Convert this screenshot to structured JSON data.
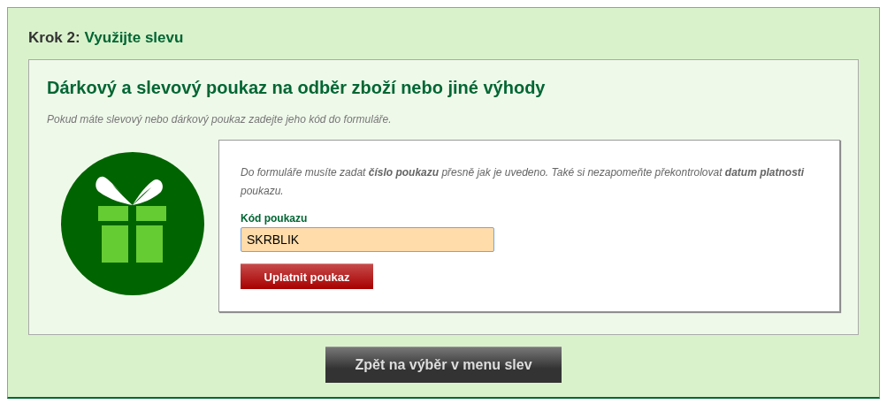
{
  "step": {
    "label": "Krok 2:",
    "title": "Využijte slevu"
  },
  "voucher_panel": {
    "title": "Dárkový a slevový poukaz na odběr zboží nebo jiné výhody",
    "intro": "Pokud máte slevový nebo dárkový poukaz zadejte jeho kód do formuláře.",
    "form": {
      "instructions": "Do formuláře musíte zadat **číslo poukazu** přesně jak je uvedeno. Také si nezapomeňte překontrolovat **datum platnosti** poukazu.",
      "field_label": "Kód poukazu",
      "field_value": "SKRBLIK",
      "submit_button": "Uplatnit poukaz"
    }
  },
  "back_button": "Zpět na výběr v menu slev"
}
